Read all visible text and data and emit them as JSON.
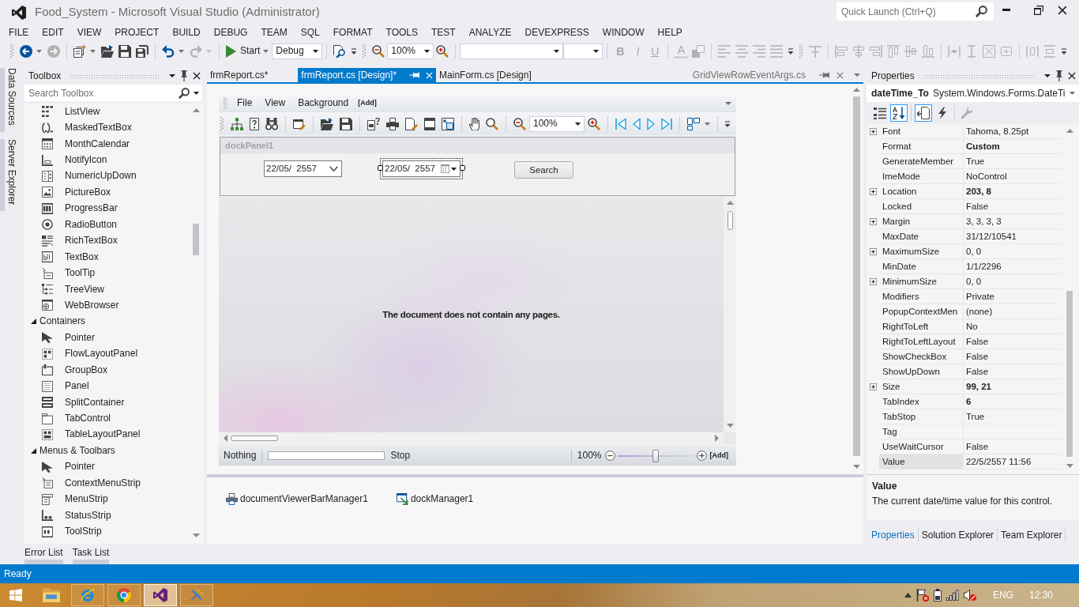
{
  "window": {
    "title": "Food_System - Microsoft Visual Studio (Administrator)",
    "quick_launch": {
      "placeholder": "Quick Launch (Ctrl+Q)"
    }
  },
  "menu": [
    "FILE",
    "EDIT",
    "VIEW",
    "PROJECT",
    "BUILD",
    "DEBUG",
    "TEAM",
    "SQL",
    "FORMAT",
    "TOOLS",
    "TEST",
    "ANALYZE",
    "DEVEXPRESS",
    "WINDOW",
    "HELP"
  ],
  "toolbar": {
    "toolbars": [
      {
        "groups": [
          {
            "items": [
              {
                "kind": "split",
                "disabled": false
              },
              {
                "kind": "button",
                "disabled": true
              }
            ]
          },
          {
            "items": [
              {
                "kind": "split",
                "disabled": false
              },
              {
                "kind": "button",
                "disabled": false
              },
              {
                "kind": "button",
                "disabled": false
              },
              {
                "kind": "button",
                "disabled": false
              }
            ]
          },
          {
            "items": [
              {
                "kind": "split",
                "disabled": false
              },
              {
                "kind": "split",
                "disabled": true
              }
            ]
          },
          {
            "items": [
              {
                "kind": "split",
                "label": "Start",
                "disabled": false
              },
              {
                "kind": "combo",
                "value": "Debug",
                "disabled": false
              }
            ]
          },
          {
            "items": [
              {
                "kind": "button",
                "disabled": false
              },
              {
                "kind": "overflow",
                "disabled": false
              }
            ]
          }
        ]
      },
      {
        "groups": [
          {
            "items": [
              {
                "kind": "button",
                "disabled": false
              },
              {
                "kind": "combo",
                "value": "100%",
                "disabled": false
              },
              {
                "kind": "button",
                "disabled": false
              }
            ]
          },
          {
            "items": [
              {
                "kind": "combo",
                "disabled": false
              },
              {
                "kind": "combo",
                "disabled": false
              }
            ]
          },
          {
            "items": [
              {
                "kind": "button",
                "label": "B",
                "disabled": true
              },
              {
                "kind": "button",
                "label": "I",
                "disabled": true
              },
              {
                "kind": "button",
                "label": "U",
                "disabled": true
              }
            ]
          },
          {
            "items": [
              {
                "kind": "button",
                "label": "A",
                "disabled": true
              },
              {
                "kind": "button",
                "disabled": true
              }
            ]
          },
          {
            "items": [
              {
                "kind": "button",
                "disabled": true
              },
              {
                "kind": "button",
                "disabled": true
              },
              {
                "kind": "button",
                "disabled": true
              },
              {
                "kind": "button",
                "disabled": true
              },
              {
                "kind": "overflow",
                "disabled": false
              }
            ]
          }
        ]
      },
      {
        "groups": [
          {
            "items": [
              {
                "kind": "button",
                "disabled": true
              }
            ]
          },
          {
            "items": [
              {
                "kind": "button",
                "disabled": true
              },
              {
                "kind": "button",
                "disabled": true
              },
              {
                "kind": "button",
                "disabled": true
              },
              {
                "kind": "button",
                "disabled": true
              },
              {
                "kind": "button",
                "disabled": true
              },
              {
                "kind": "button",
                "disabled": true
              }
            ]
          },
          {
            "items": [
              {
                "kind": "button",
                "disabled": true
              },
              {
                "kind": "button",
                "disabled": true
              },
              {
                "kind": "button",
                "disabled": true
              },
              {
                "kind": "button",
                "disabled": true
              }
            ]
          },
          {
            "items": [
              {
                "kind": "button",
                "disabled": true
              },
              {
                "kind": "button",
                "disabled": true
              },
              {
                "kind": "overflow",
                "disabled": false
              }
            ]
          }
        ]
      }
    ]
  },
  "side_tabs": [
    "Data Sources",
    "Server Explorer"
  ],
  "toolbox": {
    "title": "Toolbox",
    "search": {
      "placeholder": "Search Toolbox"
    },
    "sections": [
      {
        "items": [
          {
            "label": "ListView"
          },
          {
            "label": "MaskedTextBox"
          },
          {
            "label": "MonthCalendar"
          },
          {
            "label": "NotifyIcon"
          },
          {
            "label": "NumericUpDown"
          },
          {
            "label": "PictureBox"
          },
          {
            "label": "ProgressBar"
          },
          {
            "label": "RadioButton"
          },
          {
            "label": "RichTextBox"
          },
          {
            "label": "TextBox"
          },
          {
            "label": "ToolTip"
          },
          {
            "label": "TreeView"
          },
          {
            "label": "WebBrowser"
          }
        ]
      },
      {
        "header": "Containers",
        "expanded": true,
        "items": [
          {
            "label": "Pointer"
          },
          {
            "label": "FlowLayoutPanel"
          },
          {
            "label": "GroupBox"
          },
          {
            "label": "Panel"
          },
          {
            "label": "SplitContainer"
          },
          {
            "label": "TabControl"
          },
          {
            "label": "TableLayoutPanel"
          }
        ]
      },
      {
        "header": "Menus & Toolbars",
        "expanded": true,
        "items": [
          {
            "label": "Pointer"
          },
          {
            "label": "ContextMenuStrip"
          },
          {
            "label": "MenuStrip"
          },
          {
            "label": "StatusStrip"
          },
          {
            "label": "ToolStrip"
          }
        ]
      }
    ]
  },
  "document_tabs": [
    {
      "label": "frmReport.cs*",
      "selected": false
    },
    {
      "label": "frmReport.cs [Design]*",
      "selected": true
    },
    {
      "label": "MainForm.cs [Design]",
      "selected": false
    }
  ],
  "preview_tab": {
    "label": "GridViewRowEventArgs.cs"
  },
  "designer": {
    "form": {
      "menu": [
        {
          "label": "File",
          "kind": "item"
        },
        {
          "label": "View",
          "kind": "item"
        },
        {
          "label": "Background",
          "kind": "item"
        },
        {
          "label": "[Add]",
          "kind": "add"
        }
      ],
      "toolbar": {
        "groups": [
          {
            "items": [
              {
                "kind": "button"
              },
              {
                "kind": "button"
              },
              {
                "kind": "button"
              }
            ]
          },
          {
            "items": [
              {
                "kind": "button"
              }
            ]
          },
          {
            "items": [
              {
                "kind": "button"
              },
              {
                "kind": "button"
              }
            ]
          },
          {
            "items": [
              {
                "kind": "button"
              },
              {
                "kind": "button"
              },
              {
                "kind": "button"
              },
              {
                "kind": "button"
              },
              {
                "kind": "button"
              }
            ]
          },
          {
            "items": [
              {
                "kind": "button"
              },
              {
                "kind": "button"
              }
            ]
          },
          {
            "items": [
              {
                "kind": "button"
              },
              {
                "kind": "combo",
                "value": "100%"
              },
              {
                "kind": "button"
              }
            ]
          },
          {
            "items": [
              {
                "kind": "button"
              },
              {
                "kind": "button"
              },
              {
                "kind": "button"
              },
              {
                "kind": "button"
              }
            ]
          },
          {
            "items": [
              {
                "kind": "split"
              }
            ]
          },
          {
            "items": [
              {
                "kind": "overflow"
              }
            ]
          }
        ]
      },
      "dock_panel": {
        "title": "dockPanel1",
        "date_pickers": [
          {
            "value": "22/05/  2557",
            "kind": "chevron",
            "selected": false
          },
          {
            "value": "22/05/  2557",
            "kind": "calendar",
            "selected": true
          }
        ],
        "button": "Search"
      },
      "message": "The document does not contain any pages.",
      "status_bar": {
        "status": "Nothing",
        "progress": {
          "level": 0
        },
        "stop": "Stop",
        "zoom": "100%",
        "zoom_slider": {
          "level": 0.5
        },
        "add": "[Add]"
      }
    },
    "components": [
      "documentViewerBarManager1",
      "dockManager1"
    ]
  },
  "autohide_tabs": [
    "Error List",
    "Task List"
  ],
  "properties": {
    "title": "Properties",
    "object": {
      "name": "dateTime_To",
      "type": "System.Windows.Forms.DateTi"
    },
    "toolbar": [
      {
        "selected": false,
        "disabled": false
      },
      {
        "selected": true,
        "disabled": false
      },
      {
        "selected": true,
        "disabled": false
      },
      {
        "selected": false,
        "disabled": false
      },
      {
        "selected": false,
        "disabled": true
      }
    ],
    "rows": [
      {
        "name": "Font",
        "value": "Tahoma, 8.25pt",
        "expandable": true,
        "modified": false,
        "selected": false
      },
      {
        "name": "Format",
        "value": "Custom",
        "expandable": false,
        "modified": true,
        "selected": false
      },
      {
        "name": "GenerateMember",
        "value": "True",
        "expandable": false,
        "modified": false,
        "selected": false
      },
      {
        "name": "ImeMode",
        "value": "NoControl",
        "expandable": false,
        "modified": false,
        "selected": false
      },
      {
        "name": "Location",
        "value": "203, 8",
        "expandable": true,
        "modified": true,
        "selected": false
      },
      {
        "name": "Locked",
        "value": "False",
        "expandable": false,
        "modified": false,
        "selected": false
      },
      {
        "name": "Margin",
        "value": "3, 3, 3, 3",
        "expandable": true,
        "modified": false,
        "selected": false
      },
      {
        "name": "MaxDate",
        "value": "31/12/10541",
        "expandable": false,
        "modified": false,
        "selected": false
      },
      {
        "name": "MaximumSize",
        "value": "0, 0",
        "expandable": true,
        "modified": false,
        "selected": false
      },
      {
        "name": "MinDate",
        "value": "1/1/2296",
        "expandable": false,
        "modified": false,
        "selected": false
      },
      {
        "name": "MinimumSize",
        "value": "0, 0",
        "expandable": true,
        "modified": false,
        "selected": false
      },
      {
        "name": "Modifiers",
        "value": "Private",
        "expandable": false,
        "modified": false,
        "selected": false
      },
      {
        "name": "PopupContextMen",
        "value": "(none)",
        "expandable": false,
        "modified": false,
        "selected": false
      },
      {
        "name": "RightToLeft",
        "value": "No",
        "expandable": false,
        "modified": false,
        "selected": false
      },
      {
        "name": "RightToLeftLayout",
        "value": "False",
        "expandable": false,
        "modified": false,
        "selected": false
      },
      {
        "name": "ShowCheckBox",
        "value": "False",
        "expandable": false,
        "modified": false,
        "selected": false
      },
      {
        "name": "ShowUpDown",
        "value": "False",
        "expandable": false,
        "modified": false,
        "selected": false
      },
      {
        "name": "Size",
        "value": "99, 21",
        "expandable": true,
        "modified": true,
        "selected": false
      },
      {
        "name": "TabIndex",
        "value": "6",
        "expandable": false,
        "modified": true,
        "selected": false
      },
      {
        "name": "TabStop",
        "value": "True",
        "expandable": false,
        "modified": false,
        "selected": false
      },
      {
        "name": "Tag",
        "expandable": false,
        "selected": false
      },
      {
        "name": "UseWaitCursor",
        "value": "False",
        "expandable": false,
        "modified": false,
        "selected": false
      },
      {
        "name": "Value",
        "value": "22/5/2557 11:56",
        "expandable": false,
        "modified": false,
        "selected": true
      }
    ],
    "description": {
      "title": "Value",
      "text": "The current date/time value for this control."
    },
    "tabs": [
      {
        "label": "Properties",
        "selected": true
      },
      {
        "label": "Solution Explorer",
        "selected": false
      },
      {
        "label": "Team Explorer",
        "selected": false
      }
    ]
  },
  "status_bar": {
    "text": "Ready"
  },
  "taskbar": {
    "apps": [
      {
        "running": false,
        "selected": false
      },
      {
        "running": true,
        "selected": false
      },
      {
        "running": true,
        "selected": false
      },
      {
        "running": true,
        "selected": true
      },
      {
        "running": true,
        "selected": false
      }
    ],
    "tray": {
      "language": "ENG",
      "time": "12:30"
    }
  }
}
